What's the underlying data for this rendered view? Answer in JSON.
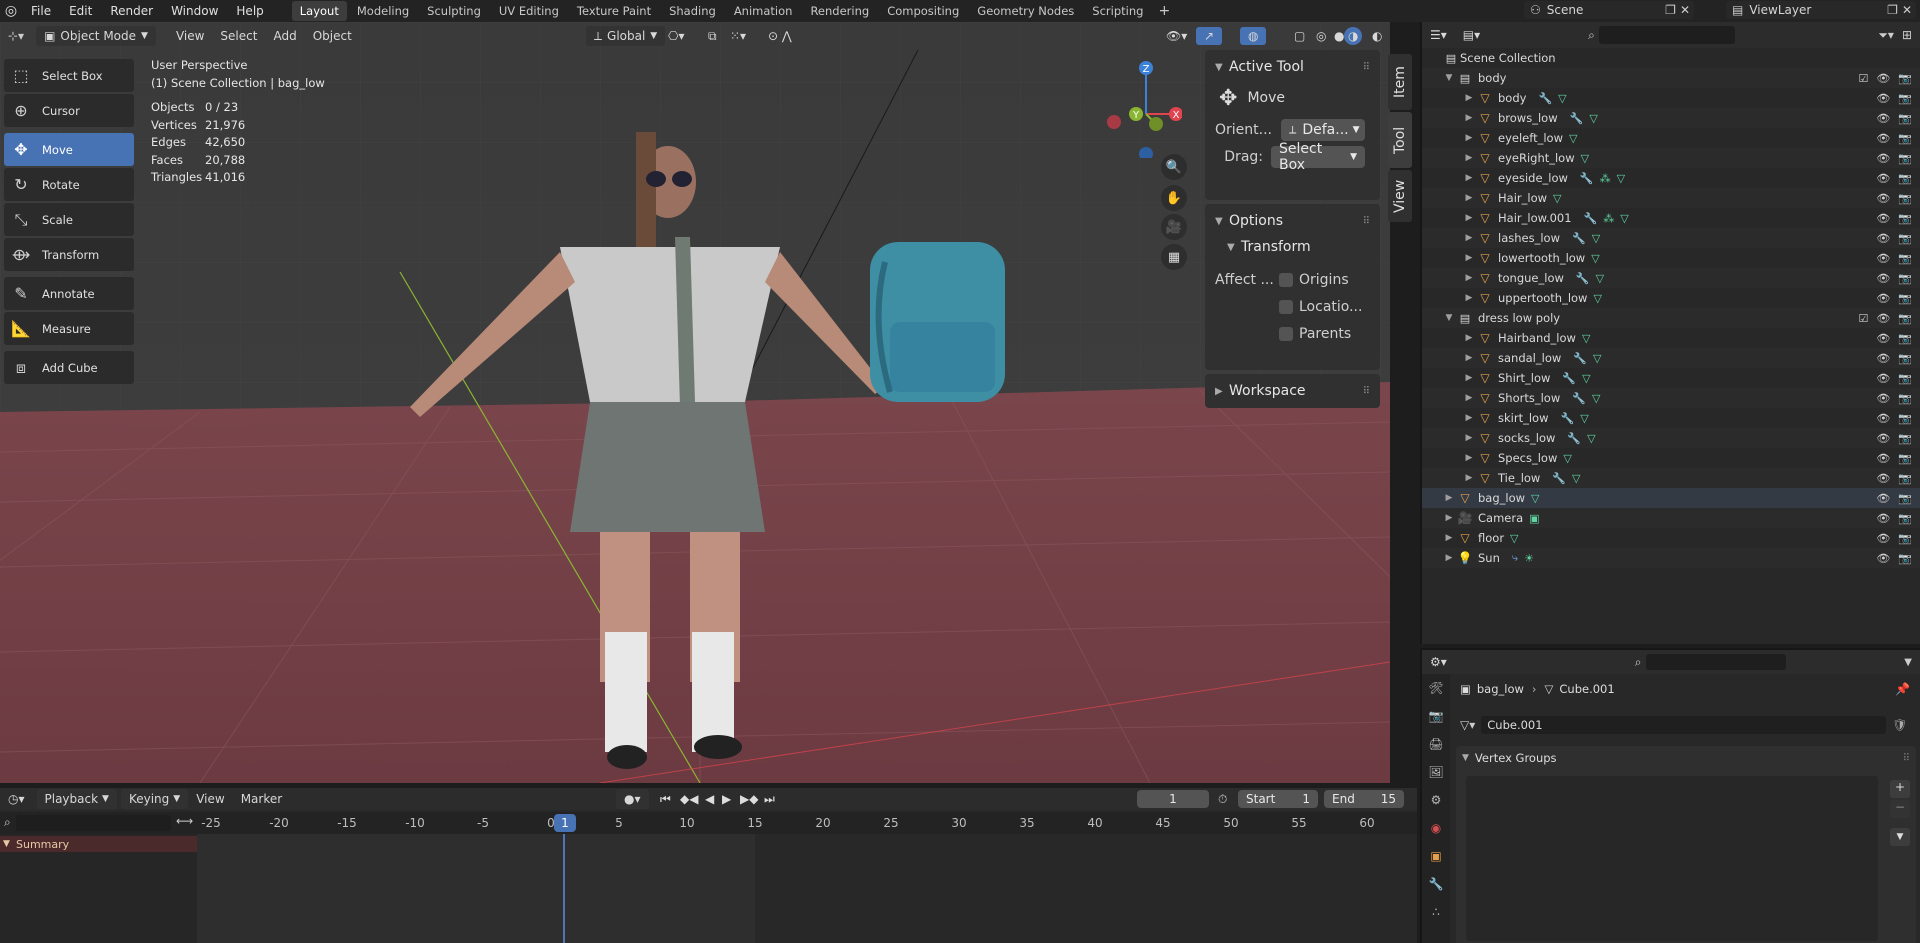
{
  "topbar": {
    "menus": [
      "File",
      "Edit",
      "Render",
      "Window",
      "Help"
    ],
    "workspaces": [
      "Layout",
      "Modeling",
      "Sculpting",
      "UV Editing",
      "Texture Paint",
      "Shading",
      "Animation",
      "Rendering",
      "Compositing",
      "Geometry Nodes",
      "Scripting"
    ],
    "active_workspace": "Layout",
    "add_workspace": "+",
    "scene": "Scene",
    "view_layer": "ViewLayer"
  },
  "viewport": {
    "mode": "Object Mode",
    "menus": [
      "View",
      "Select",
      "Add",
      "Object"
    ],
    "orientation": "Global",
    "perspective": "User Perspective",
    "collection_info": "(1) Scene Collection | bag_low",
    "stats": [
      {
        "label": "Objects",
        "value": "0 / 23"
      },
      {
        "label": "Vertices",
        "value": "21,976"
      },
      {
        "label": "Edges",
        "value": "42,650"
      },
      {
        "label": "Faces",
        "value": "20,788"
      },
      {
        "label": "Triangles",
        "value": "41,016"
      }
    ],
    "tools": [
      {
        "label": "Select Box",
        "icon": "select-box-icon"
      },
      {
        "label": "Cursor",
        "icon": "cursor-icon"
      },
      {
        "label": "Move",
        "icon": "move-icon",
        "active": true
      },
      {
        "label": "Rotate",
        "icon": "rotate-icon"
      },
      {
        "label": "Scale",
        "icon": "scale-icon"
      },
      {
        "label": "Transform",
        "icon": "transform-icon"
      },
      {
        "label": "Annotate",
        "icon": "annotate-icon"
      },
      {
        "label": "Measure",
        "icon": "measure-icon"
      },
      {
        "label": "Add Cube",
        "icon": "add-cube-icon"
      }
    ],
    "gizmo": {
      "x": "X",
      "y": "Y",
      "z": "Z"
    }
  },
  "npanel": {
    "tabs": [
      "Item",
      "Tool",
      "View"
    ],
    "active_tool_title": "Active Tool",
    "active_tool_name": "Move",
    "orient_label": "Orient...",
    "orient_value": "Defa...",
    "drag_label": "Drag:",
    "drag_value": "Select Box",
    "options_title": "Options",
    "transform_title": "Transform",
    "affect_label": "Affect ...",
    "affect_options": [
      "Origins",
      "Locatio...",
      "Parents"
    ],
    "workspace_title": "Workspace"
  },
  "outliner": {
    "root": "Scene Collection",
    "rows": [
      {
        "label": "body",
        "type": "collection",
        "depth": 1,
        "open": true,
        "check": true
      },
      {
        "label": "body",
        "type": "object",
        "depth": 2,
        "icons": [
          "wrench",
          "mesh"
        ]
      },
      {
        "label": "brows_low",
        "type": "object",
        "depth": 2,
        "icons": [
          "wrench",
          "mesh"
        ]
      },
      {
        "label": "eyeleft_low",
        "type": "object",
        "depth": 2,
        "icons": [
          "mesh"
        ]
      },
      {
        "label": "eyeRight_low",
        "type": "object",
        "depth": 2,
        "icons": [
          "mesh"
        ]
      },
      {
        "label": "eyeside_low",
        "type": "object",
        "depth": 2,
        "icons": [
          "wrench",
          "grid",
          "mesh"
        ]
      },
      {
        "label": "Hair_low",
        "type": "object",
        "depth": 2,
        "icons": [
          "mesh"
        ]
      },
      {
        "label": "Hair_low.001",
        "type": "object",
        "depth": 2,
        "icons": [
          "wrench",
          "grid",
          "mesh"
        ]
      },
      {
        "label": "lashes_low",
        "type": "object",
        "depth": 2,
        "icons": [
          "wrench",
          "mesh"
        ]
      },
      {
        "label": "lowertooth_low",
        "type": "object",
        "depth": 2,
        "icons": [
          "mesh"
        ]
      },
      {
        "label": "tongue_low",
        "type": "object",
        "depth": 2,
        "icons": [
          "wrench",
          "mesh"
        ]
      },
      {
        "label": "uppertooth_low",
        "type": "object",
        "depth": 2,
        "icons": [
          "mesh"
        ]
      },
      {
        "label": "dress low poly",
        "type": "collection",
        "depth": 1,
        "open": true,
        "check": true
      },
      {
        "label": "Hairband_low",
        "type": "object",
        "depth": 2,
        "icons": [
          "mesh"
        ]
      },
      {
        "label": "sandal_low",
        "type": "object",
        "depth": 2,
        "icons": [
          "wrench",
          "mesh"
        ]
      },
      {
        "label": "Shirt_low",
        "type": "object",
        "depth": 2,
        "icons": [
          "wrench",
          "mesh"
        ]
      },
      {
        "label": "Shorts_low",
        "type": "object",
        "depth": 2,
        "icons": [
          "wrench",
          "mesh"
        ]
      },
      {
        "label": "skirt_low",
        "type": "object",
        "depth": 2,
        "icons": [
          "wrench",
          "mesh"
        ]
      },
      {
        "label": "socks_low",
        "type": "object",
        "depth": 2,
        "icons": [
          "wrench",
          "mesh"
        ]
      },
      {
        "label": "Specs_low",
        "type": "object",
        "depth": 2,
        "icons": [
          "mesh"
        ]
      },
      {
        "label": "Tie_low",
        "type": "object",
        "depth": 2,
        "icons": [
          "wrench",
          "mesh"
        ]
      },
      {
        "label": "bag_low",
        "type": "object",
        "depth": 1,
        "icons": [
          "mesh"
        ],
        "selected": true
      },
      {
        "label": "Camera",
        "type": "camera",
        "depth": 1,
        "icons": [
          "camera-data"
        ]
      },
      {
        "label": "floor",
        "type": "object",
        "depth": 1,
        "icons": [
          "mesh"
        ]
      },
      {
        "label": "Sun",
        "type": "light",
        "depth": 1,
        "icons": [
          "constraint",
          "sun"
        ]
      }
    ]
  },
  "properties": {
    "breadcrumb_object": "bag_low",
    "breadcrumb_data": "Cube.001",
    "data_name": "Cube.001",
    "panel_title": "Vertex Groups"
  },
  "timeline": {
    "menus": [
      "Playback",
      "Keying",
      "View",
      "Marker"
    ],
    "current_frame": "1",
    "start_label": "Start",
    "start_value": "1",
    "end_label": "End",
    "end_value": "15",
    "ticks": [
      "-25",
      "-20",
      "-15",
      "-10",
      "-5",
      "0",
      "5",
      "10",
      "15",
      "20",
      "25",
      "30",
      "35",
      "40",
      "45",
      "50",
      "55",
      "60"
    ],
    "playhead": "1",
    "summary": "Summary"
  },
  "colors": {
    "accent": "#4772b3",
    "floor": "#6b3a40",
    "x_axis": "#e0444f",
    "y_axis": "#8ab532",
    "z_axis": "#3b82d8",
    "object_icon": "#e79e4a",
    "mesh_icon": "#5fd3a0"
  }
}
